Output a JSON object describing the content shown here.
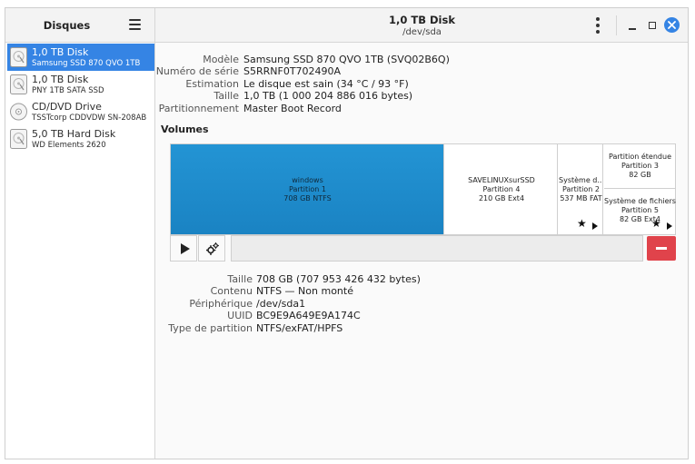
{
  "sidebar": {
    "title": "Disques",
    "items": [
      {
        "name": "1,0 TB Disk",
        "sub": "Samsung SSD 870 QVO 1TB",
        "icon": "hard-disk-icon"
      },
      {
        "name": "1,0 TB Disk",
        "sub": "PNY 1TB SATA SSD",
        "icon": "hard-disk-icon"
      },
      {
        "name": "CD/DVD Drive",
        "sub": "TSSTcorp CDDVDW SN-208AB",
        "icon": "optical-disc-icon"
      },
      {
        "name": "5,0 TB Hard Disk",
        "sub": "WD Elements 2620",
        "icon": "hard-disk-icon"
      }
    ]
  },
  "header": {
    "title": "1,0 TB Disk",
    "subtitle": "/dev/sda"
  },
  "colors": {
    "accent": "#3584e4",
    "selected_partition": "#1e88c9",
    "delete": "#e0434b"
  },
  "disk_info": [
    {
      "key": "Modèle",
      "value": "Samsung SSD 870 QVO 1TB (SVQ02B6Q)"
    },
    {
      "key": "Numéro de série",
      "value": "S5RRNF0T702490A"
    },
    {
      "key": "Estimation",
      "value": "Le disque est sain (34 °C / 93 °F)"
    },
    {
      "key": "Taille",
      "value": "1,0 TB (1 000 204 886 016 bytes)"
    },
    {
      "key": "Partitionnement",
      "value": "Master Boot Record"
    }
  ],
  "volumes_title": "Volumes",
  "partitions": {
    "p1": {
      "name": "windows",
      "part": "Partition 1",
      "size": "708 GB NTFS"
    },
    "p4": {
      "name": "SAVELINUXsurSSD",
      "part": "Partition 4",
      "size": "210 GB Ext4"
    },
    "p2": {
      "name": "Système d...",
      "part": "Partition 2",
      "size": "537 MB FAT"
    },
    "p3": {
      "name": "Partition étendue",
      "part": "Partition 3",
      "size": "82 GB"
    },
    "p5": {
      "name": "Système de fichiers",
      "part": "Partition 5",
      "size": "82 GB Ext4"
    }
  },
  "star_glyph": "★",
  "volume_info": [
    {
      "key": "Taille",
      "value": "708 GB (707 953 426 432 bytes)"
    },
    {
      "key": "Contenu",
      "value": "NTFS — Non monté"
    },
    {
      "key": "Périphérique",
      "value": "/dev/sda1"
    },
    {
      "key": "UUID",
      "value": "BC9E9A649E9A174C"
    },
    {
      "key": "Type de partition",
      "value": "NTFS/exFAT/HPFS"
    }
  ]
}
